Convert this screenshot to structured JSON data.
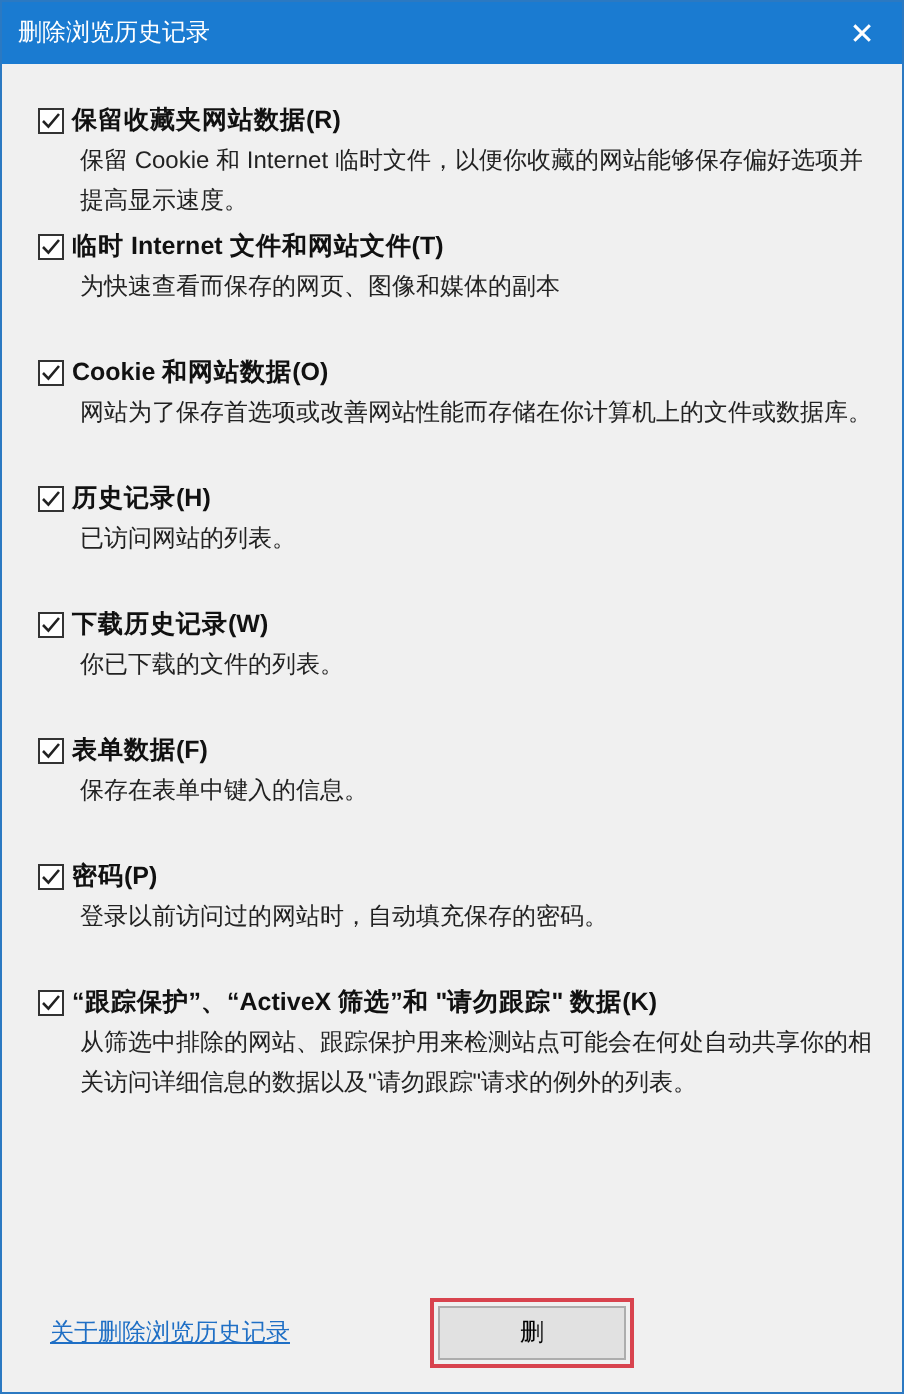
{
  "window": {
    "title": "删除浏览历史记录",
    "close": "✕"
  },
  "options": [
    {
      "label": "保留收藏夹网站数据(R)",
      "description": "保留 Cookie 和 Internet 临时文件，以便你收藏的网站能够保存偏好选项并提高显示速度。",
      "checked": true
    },
    {
      "label": "临时 Internet 文件和网站文件(T)",
      "description": "为快速查看而保存的网页、图像和媒体的副本",
      "checked": true
    },
    {
      "label": "Cookie 和网站数据(O)",
      "description": "网站为了保存首选项或改善网站性能而存储在你计算机上的文件或数据库。",
      "checked": true
    },
    {
      "label": "历史记录(H)",
      "description": "已访问网站的列表。",
      "checked": true
    },
    {
      "label": "下载历史记录(W)",
      "description": "你已下载的文件的列表。",
      "checked": true
    },
    {
      "label": "表单数据(F)",
      "description": "保存在表单中键入的信息。",
      "checked": true
    },
    {
      "label": "密码(P)",
      "description": "登录以前访问过的网站时，自动填充保存的密码。",
      "checked": true
    },
    {
      "label": "“跟踪保护”、“ActiveX 筛选”和 \"请勿跟踪\" 数据(K)",
      "description": "从筛选中排除的网站、跟踪保护用来检测站点可能会在何处自动共享你的相关访问详细信息的数据以及\"请勿跟踪\"请求的例外的列表。",
      "checked": true
    }
  ],
  "footer": {
    "link": "关于删除浏览历史记录",
    "button": "删",
    "highlighted": true
  }
}
